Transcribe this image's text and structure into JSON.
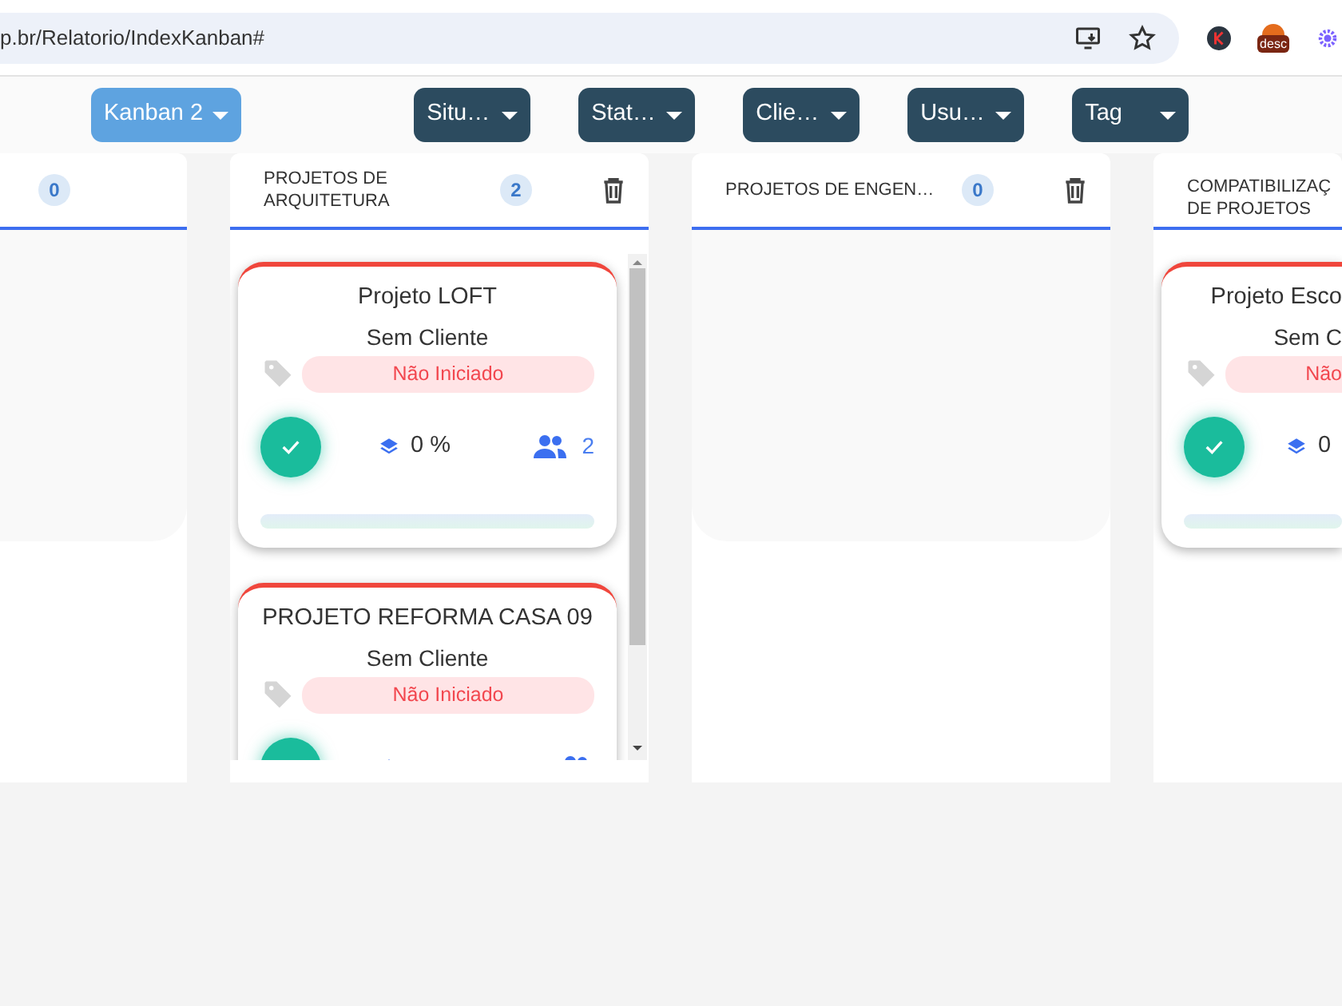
{
  "browser": {
    "address": "p.br/Relatorio/IndexKanban#",
    "extension_label": "desc"
  },
  "toolbar": {
    "buttons": [
      {
        "label": "Kanban 2",
        "kind": "primary"
      },
      {
        "label": "Situ…",
        "kind": "filter"
      },
      {
        "label": "Stat…",
        "kind": "filter"
      },
      {
        "label": "Clie…",
        "kind": "filter"
      },
      {
        "label": "Usu…",
        "kind": "filter"
      },
      {
        "label": "Tag",
        "kind": "filter"
      }
    ]
  },
  "columns": [
    {
      "count": "0"
    },
    {
      "title": "PROJETOS DE ARQUITETURA",
      "count": "2",
      "trash": true,
      "scrollable": true,
      "cards": [
        {
          "title": "Projeto LOFT",
          "client": "Sem Cliente",
          "status": "Não Iniciado",
          "progress": "0 %",
          "members": "2",
          "level": 0
        },
        {
          "title": "PROJETO REFORMA CASA 09",
          "client": "Sem Cliente",
          "status": "Não Iniciado"
        }
      ]
    },
    {
      "title": "PROJETOS DE ENGEN…",
      "count": "0",
      "trash": true
    },
    {
      "title": "COMPATIBILIZAÇ DE PROJETOS",
      "cut": true,
      "cards": [
        {
          "title": "Projeto Esco",
          "client": "Sem C",
          "status": "Não",
          "progress": "0",
          "level": 0
        }
      ]
    }
  ]
}
